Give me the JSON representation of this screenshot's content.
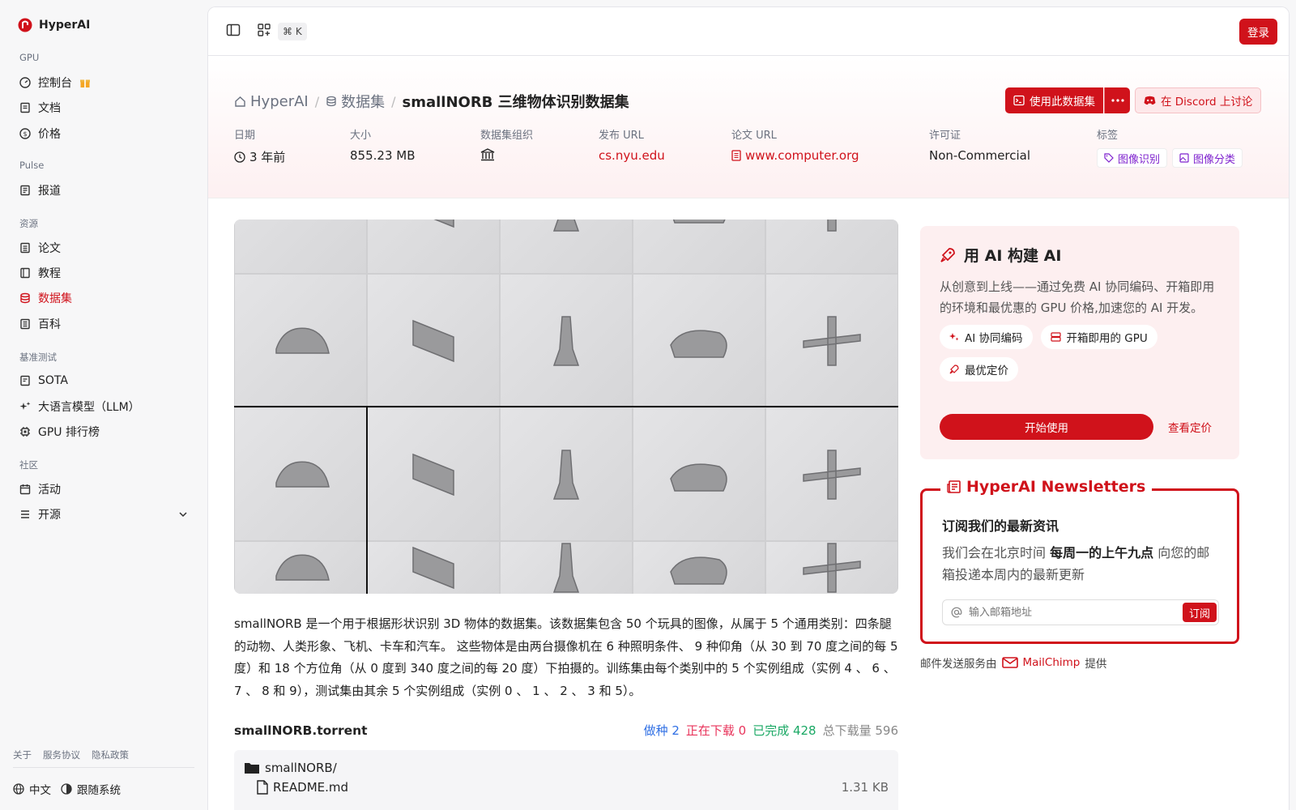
{
  "app": {
    "name": "HyperAI"
  },
  "sidebar": {
    "sections": [
      {
        "label": "GPU",
        "items": [
          {
            "label": "控制台",
            "icon": "gauge-icon"
          },
          {
            "label": "文档",
            "icon": "doc-icon"
          },
          {
            "label": "价格",
            "icon": "dollar-icon"
          }
        ]
      },
      {
        "label": "Pulse",
        "items": [
          {
            "label": "报道",
            "icon": "news-icon"
          }
        ]
      },
      {
        "label": "资源",
        "items": [
          {
            "label": "论文",
            "icon": "paper-icon"
          },
          {
            "label": "教程",
            "icon": "book-icon"
          },
          {
            "label": "数据集",
            "icon": "database-icon"
          },
          {
            "label": "百科",
            "icon": "wiki-icon"
          }
        ]
      },
      {
        "label": "基准测试",
        "items": [
          {
            "label": "SOTA",
            "icon": "trophy-icon"
          },
          {
            "label": "大语言模型（LLM）",
            "icon": "sparkle-icon"
          },
          {
            "label": "GPU 排行榜",
            "icon": "chip-icon"
          }
        ]
      },
      {
        "label": "社区",
        "items": [
          {
            "label": "活动",
            "icon": "calendar-icon"
          },
          {
            "label": "开源",
            "icon": "list-icon"
          }
        ]
      }
    ],
    "footer_links": [
      "关于",
      "服务协议",
      "隐私政策"
    ],
    "language": "中文",
    "theme": "跟随系统"
  },
  "topbar": {
    "shortcut": "⌘ K",
    "login": "登录"
  },
  "breadcrumb": {
    "home": "HyperAI",
    "section": "数据集",
    "current": "smallNORB 三维物体识别数据集"
  },
  "actions": {
    "use_dataset": "使用此数据集",
    "discord": "在 Discord 上讨论"
  },
  "meta": {
    "date_label": "日期",
    "date_value": "3 年前",
    "size_label": "大小",
    "size_value": "855.23 MB",
    "org_label": "数据集组织",
    "pub_url_label": "发布 URL",
    "pub_url_value": "cs.nyu.edu",
    "paper_url_label": "论文 URL",
    "paper_url_value": "www.computer.org",
    "license_label": "许可证",
    "license_value": "Non-Commercial",
    "tags_label": "标签",
    "tags": [
      "图像识别",
      "图像分类"
    ]
  },
  "description": "smallNORB 是一个用于根据形状识别 3D 物体的数据集。该数据集包含 50 个玩具的图像，从属于 5 个通用类别：四条腿的动物、人类形象、飞机、卡车和汽车。 这些物体是由两台摄像机在 6 种照明条件、 9 种仰角（从 30 到 70 度之间的每 5 度）和 18 个方位角（从 0 度到 340 度之间的每 20 度）下拍摄的。训练集由每个类别中的 5 个实例组成（实例 4 、 6 、 7 、 8 和 9），测试集由其余 5 个实例组成（实例 0 、 1 、 2 、 3 和 5）。",
  "torrent": {
    "title": "smallNORB.torrent",
    "seeding": "做种 2",
    "downloading": "正在下载 0",
    "completed": "已完成 428",
    "total": "总下载量 596",
    "folder": "smallNORB/",
    "files": [
      {
        "name": "README.md",
        "size": "1.31 KB"
      }
    ]
  },
  "promo": {
    "title": "用 AI 构建 AI",
    "body": "从创意到上线——通过免费 AI 协同编码、开箱即用的环境和最优惠的 GPU 价格,加速您的 AI 开发。",
    "chips": [
      "AI 协同编码",
      "开箱即用的 GPU",
      "最优定价"
    ],
    "start": "开始使用",
    "pricing": "查看定价"
  },
  "newsletter": {
    "title": "HyperAI Newsletters",
    "heading": "订阅我们的最新资讯",
    "text_before": "我们会在北京时间",
    "text_bold": "每周一的上午九点",
    "text_after": "向您的邮箱投递本周内的最新更新",
    "placeholder": "输入邮箱地址",
    "subscribe": "订阅",
    "provider_prefix": "邮件发送服务由",
    "provider": "MailChimp",
    "provider_suffix": "提供"
  },
  "colors": {
    "accent": "#d0121b",
    "promo_bg": "#fdeff0",
    "seeding": "#2f6fe4",
    "downloading": "#e8345b",
    "completed": "#1aa864",
    "total": "#888888"
  }
}
